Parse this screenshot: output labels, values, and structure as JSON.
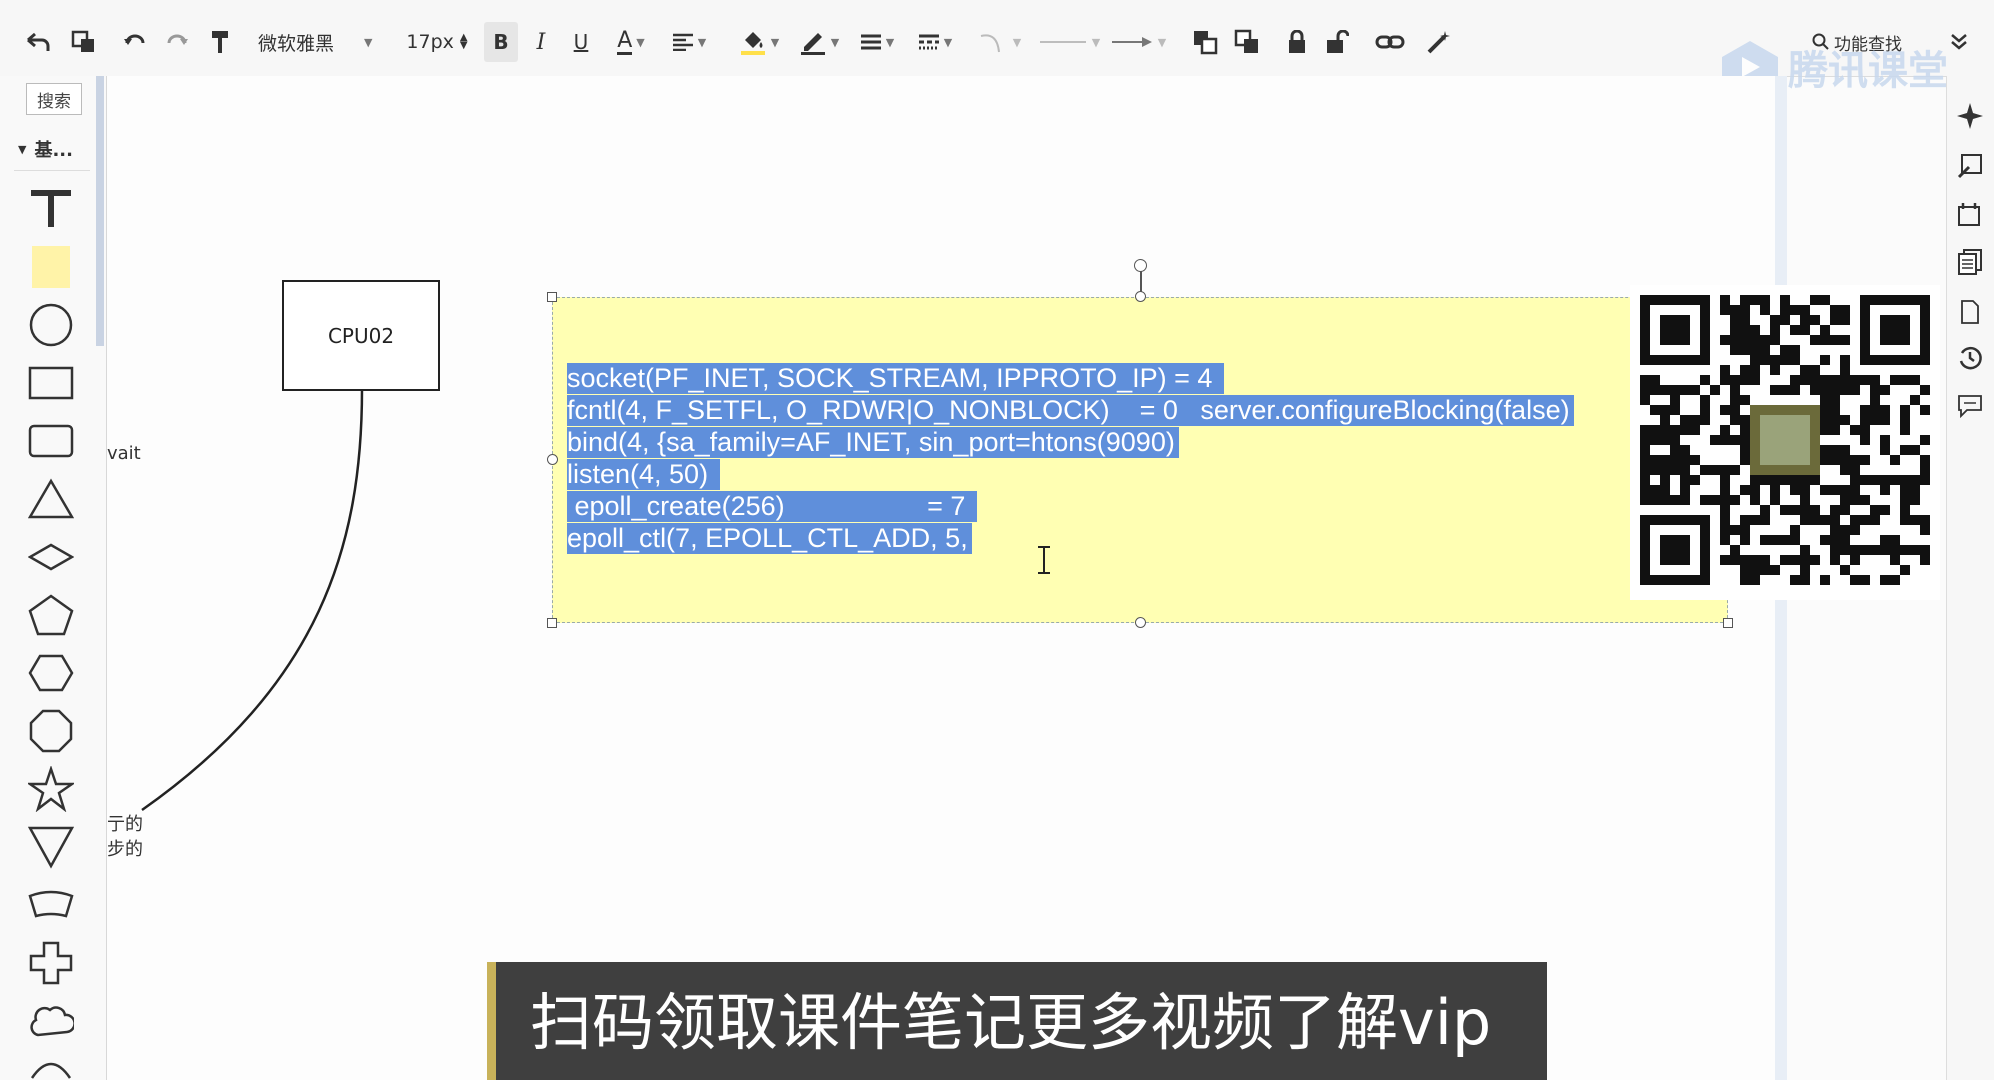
{
  "toolbar": {
    "font_name": "微软雅黑",
    "font_size": "17px",
    "bold": "B",
    "italic": "I",
    "underline": "U",
    "font_color": "A",
    "search_label": "功能查找"
  },
  "sidebar": {
    "search_label": "搜索",
    "category_label": "基..."
  },
  "canvas": {
    "cpu_label": "CPU02",
    "partial_text_wait": "vait",
    "partial_text_1": "亍的",
    "partial_text_2": "步的",
    "note_lines": [
      "socket(PF_INET, SOCK_STREAM, IPPROTO_IP) = 4 ",
      "fcntl(4, F_SETFL, O_RDWR|O_NONBLOCK)    = 0   server.configureBlocking(false)",
      "bind(4, {sa_family=AF_INET, sin_port=htons(9090)",
      "listen(4, 50) ",
      " epoll_create(256)                   = 7 ",
      "epoll_ctl(7, EPOLL_CTL_ADD, 5,"
    ]
  },
  "watermark": "腾讯课堂",
  "banner": {
    "text": "扫码领取课件笔记更多视频了解vip"
  },
  "colors": {
    "note_bg": "#ffffb3",
    "selection": "#5f8fdb",
    "banner_bg": "#3f3f3f"
  }
}
